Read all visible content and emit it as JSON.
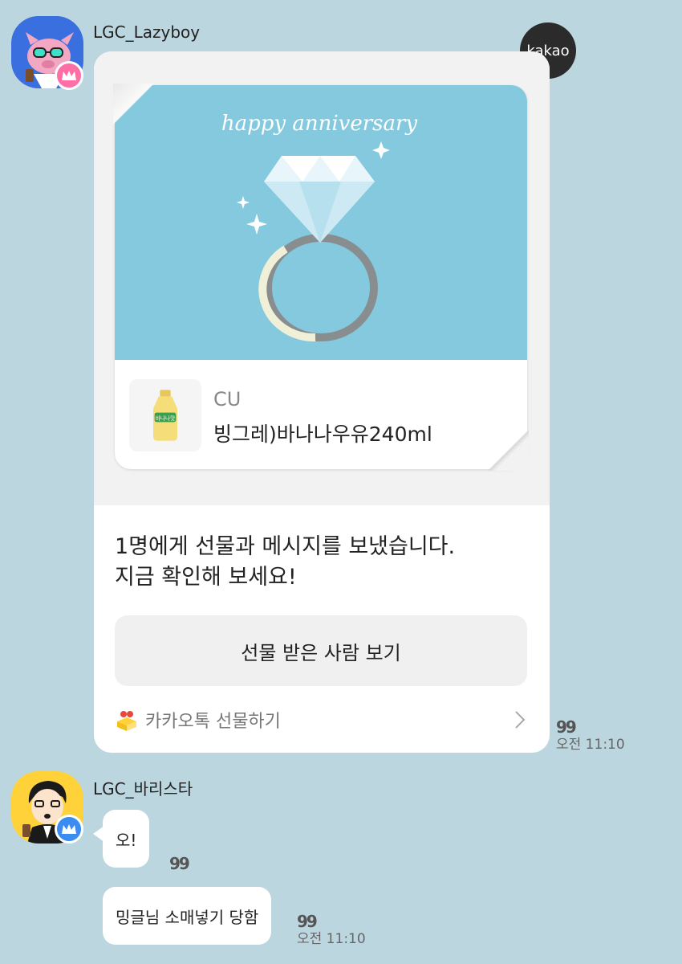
{
  "messages": {
    "first": {
      "sender": "LGC_Lazyboy",
      "gift": {
        "image_title": "happy anniversary",
        "brand": "CU",
        "product": "빙그레)바나나우유240ml",
        "product_label": "바나나맛",
        "message": "1명에게 선물과 메시지를 보냈습니다.\n지금 확인해 보세요!",
        "button": "선물 받은 사람 보기",
        "footer": "카카오톡 선물하기"
      },
      "read_mark": "99",
      "time": "오전 11:10"
    },
    "second": {
      "sender": "LGC_바리스타",
      "bubbles": [
        {
          "text": "오!",
          "read_mark": "99"
        },
        {
          "text": "밍글님 소매넣기 당함",
          "read_mark": "99",
          "time": "오전 11:10"
        }
      ]
    }
  },
  "kakao_badge": "kakao",
  "colors": {
    "background": "#bcd6e0",
    "gift_image_bg": "#85c9de",
    "lazyboy_avatar_bg": "#3a6fe0",
    "lazyboy_crown_badge": "#ff6fa6",
    "barista_avatar_bg": "#ffd23a",
    "barista_crown_badge": "#3a8cf0"
  },
  "icons": [
    "pig-avatar",
    "barista-avatar",
    "crown-icon",
    "diamond-ring-image",
    "banana-milk-image",
    "gift-box-icon",
    "chevron-right-icon"
  ]
}
